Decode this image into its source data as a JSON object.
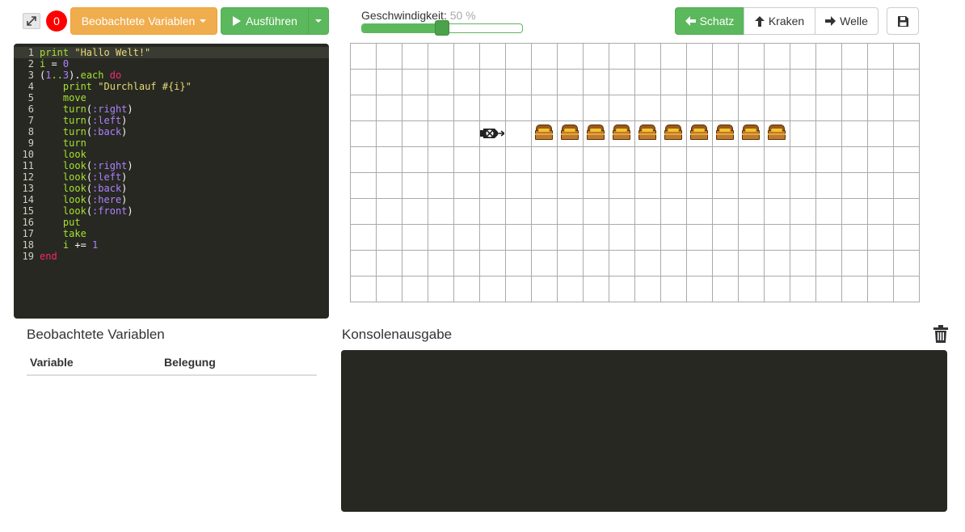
{
  "toolbar": {
    "error_count": "0",
    "watched_variables_label": "Beobachtete Variablen",
    "run_label": "Ausführen"
  },
  "speed": {
    "label": "Geschwindigkeit:",
    "value_text": "50 %",
    "value_fraction": 0.5
  },
  "insert_buttons": {
    "treasure": "Schatz",
    "kraken": "Kraken",
    "wave": "Welle"
  },
  "editor": {
    "lines": [
      "print \"Hallo Welt!\"",
      "i = 0",
      "(1..3).each do",
      "    print \"Durchlauf #{i}\"",
      "    move",
      "    turn(:right)",
      "    turn(:left)",
      "    turn(:back)",
      "    turn",
      "    look",
      "    look(:right)",
      "    look(:left)",
      "    look(:back)",
      "    look(:here)",
      "    look(:front)",
      "    put",
      "    take",
      "    i += 1",
      "end"
    ]
  },
  "world": {
    "columns": 22,
    "rows": 10,
    "ship": {
      "col": 5,
      "row": 3,
      "direction": "right"
    },
    "treasures": [
      {
        "col": 7,
        "row": 3
      },
      {
        "col": 8,
        "row": 3
      },
      {
        "col": 9,
        "row": 3
      },
      {
        "col": 10,
        "row": 3
      },
      {
        "col": 11,
        "row": 3
      },
      {
        "col": 12,
        "row": 3
      },
      {
        "col": 13,
        "row": 3
      },
      {
        "col": 14,
        "row": 3
      },
      {
        "col": 15,
        "row": 3
      },
      {
        "col": 16,
        "row": 3
      }
    ]
  },
  "watch_panel": {
    "title": "Beobachtete Variablen",
    "col_variable": "Variable",
    "col_value": "Belegung"
  },
  "console": {
    "title": "Konsolenausgabe",
    "output": ""
  },
  "colors": {
    "success": "#5cb85c",
    "warning": "#f0ad4e",
    "danger": "#ff0000",
    "editor_bg": "#272822"
  },
  "icons": {
    "expand": "expand-arrows-icon",
    "play": "play-icon",
    "caret": "caret-down-icon",
    "arrow_left": "arrow-left-icon",
    "arrow_up": "arrow-up-icon",
    "arrow_right": "arrow-right-icon",
    "save": "floppy-disk-icon",
    "trash": "trash-icon",
    "ship": "pirate-ship-icon",
    "treasure": "treasure-chest-icon"
  }
}
